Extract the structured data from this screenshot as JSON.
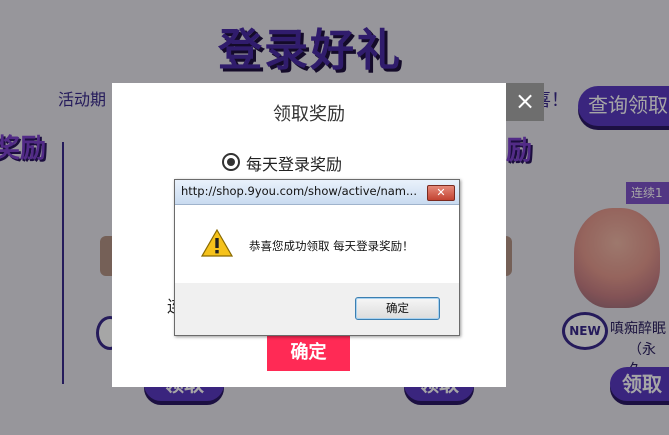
{
  "background": {
    "banner_title": "登录好礼",
    "period_text": "活动期",
    "surprise_text": "惊喜！",
    "query_button": "查询领取",
    "left_award_heading": "奖励",
    "mid_award_heading": "励",
    "streak_tag": "连续1",
    "new_badge": "NEW",
    "item_name": "嗔痴醉眠",
    "item_duration": "（永久",
    "claim_left": "领取",
    "claim_mid": "领取",
    "claim_right": "领取"
  },
  "reward_modal": {
    "title": "领取奖励",
    "close_icon": "×",
    "option_label": "每天登录奖励",
    "partial_text": "连",
    "confirm_button": "确定"
  },
  "alert_dialog": {
    "title": "http://shop.9you.com/show/active/nam...",
    "close_icon": "✕",
    "icon": "warning-icon",
    "message": "恭喜您成功领取 每天登录奖励！",
    "ok_button": "确定"
  },
  "colors": {
    "accent_purple": "#5a39c2",
    "confirm_red": "#ff2a55",
    "alert_border_blue": "#3c7fb1"
  }
}
